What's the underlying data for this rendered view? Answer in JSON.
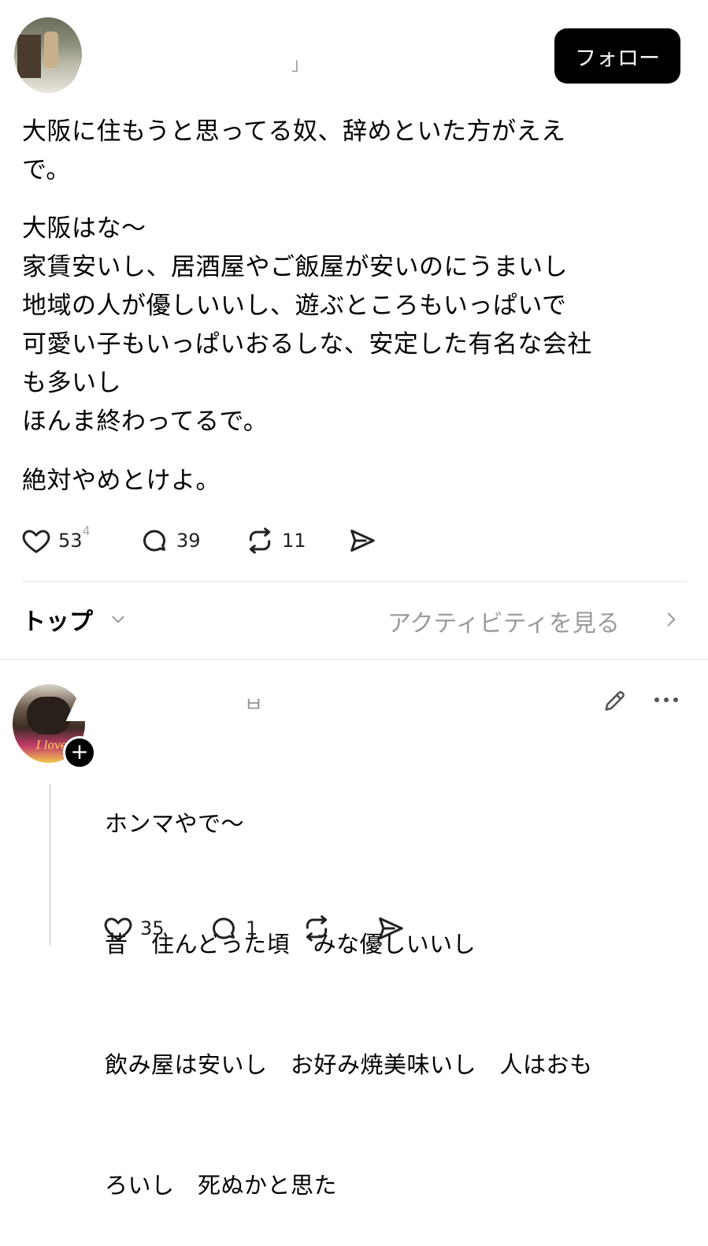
{
  "post": {
    "follow_label": "フォロー",
    "lines_p1": [
      "大阪に住もうと思ってる奴、辞めといた方がええ",
      "で。"
    ],
    "lines_p2": [
      "大阪はな〜",
      "家賃安いし、居酒屋やご飯屋が安いのにうまいし",
      "地域の人が優しいいし、遊ぶところもいっぱいで",
      "可愛い子もいっぱいおるしな、安定した有名な会社",
      "も多いし",
      "ほんま終わってるで。"
    ],
    "lines_p3": [
      "絶対やめとけよ。"
    ],
    "actions": {
      "likes": "53",
      "likes_sup": "4",
      "replies": "39",
      "reposts": "11"
    }
  },
  "sort": {
    "label": "トップ",
    "activity_link": "アクティビティを見る"
  },
  "reply": {
    "avatar_caption": "I love",
    "lines": [
      "ホンマやで〜",
      "昔　住んどった頃　みな優しいいし",
      "飲み屋は安いし　お好み焼美味いし　人はおも",
      "ろいし　死ぬかと思た"
    ],
    "actions": {
      "likes": "35",
      "replies": "1"
    }
  },
  "icons": [
    "heart-icon",
    "comment-icon",
    "repost-icon",
    "share-icon",
    "chevron-down-icon",
    "chevron-right-icon",
    "edit-icon",
    "more-icon",
    "plus-icon"
  ],
  "colors": {
    "primary": "#000000",
    "muted": "#9a9a9a",
    "divider": "#e1e1e1"
  }
}
